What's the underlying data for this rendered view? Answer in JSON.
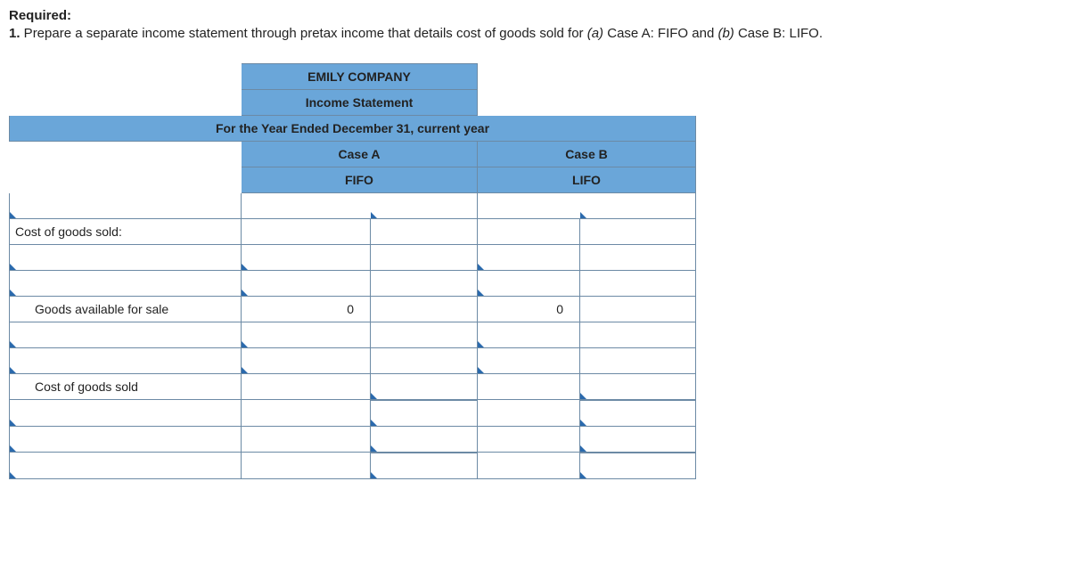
{
  "prompt": {
    "required_label": "Required:",
    "item_number": "1.",
    "body_before_a": " Prepare a separate income statement through pretax income that details cost of goods sold for ",
    "a_label": "(a)",
    "body_after_a": " Case A: FIFO and ",
    "b_label": "(b)",
    "body_after_b": " Case B: LIFO."
  },
  "header": {
    "company": "EMILY COMPANY",
    "title": "Income Statement",
    "period": "For the Year Ended December 31, current year",
    "case_a": "Case A",
    "case_b": "Case B",
    "fifo": "FIFO",
    "lifo": "LIFO"
  },
  "rows": {
    "cogs_header": "Cost of goods sold:",
    "goods_avail": "Goods available for sale",
    "cogs_total": "Cost of goods sold",
    "zero": "0"
  }
}
